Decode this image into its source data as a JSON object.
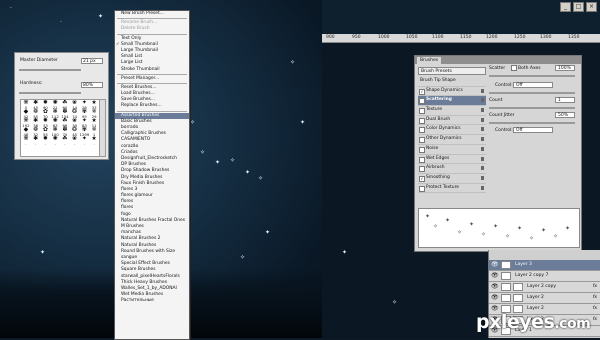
{
  "brush_picker": {
    "master_diameter_label": "Master Diameter",
    "master_diameter_value": "21 px",
    "hardness_label": "Hardness:",
    "hardness_value": "80%",
    "tips": [
      "5",
      "45",
      "90",
      "21",
      "60",
      "14",
      "26",
      "33",
      "42",
      "55",
      "70",
      "112",
      "134",
      "74",
      "95",
      "29",
      "192",
      "36",
      "33",
      "63",
      "66",
      "39",
      "63",
      "11",
      "48",
      "32",
      "55",
      "100",
      "75",
      "45",
      "1299",
      "1",
      ".",
      ".",
      ".",
      ".",
      ".",
      ".",
      ".",
      "."
    ]
  },
  "menu": {
    "items": [
      {
        "label": "New Brush Preset...",
        "state": "normal"
      },
      {
        "sep": true
      },
      {
        "label": "Rename Brush...",
        "state": "disabled"
      },
      {
        "label": "Delete Brush",
        "state": "disabled"
      },
      {
        "sep": true
      },
      {
        "label": "Text Only",
        "state": "normal"
      },
      {
        "label": "Small Thumbnail",
        "state": "checked"
      },
      {
        "label": "Large Thumbnail",
        "state": "normal"
      },
      {
        "label": "Small List",
        "state": "normal"
      },
      {
        "label": "Large List",
        "state": "normal"
      },
      {
        "label": "Stroke Thumbnail",
        "state": "normal"
      },
      {
        "sep": true
      },
      {
        "label": "Preset Manager...",
        "state": "normal"
      },
      {
        "sep": true
      },
      {
        "label": "Reset Brushes...",
        "state": "normal"
      },
      {
        "label": "Load Brushes...",
        "state": "normal"
      },
      {
        "label": "Save Brushes...",
        "state": "normal"
      },
      {
        "label": "Replace Brushes...",
        "state": "normal"
      },
      {
        "sep": true
      },
      {
        "label": "Assorted Brushes",
        "state": "selected"
      },
      {
        "label": "Basic Brushes",
        "state": "normal"
      },
      {
        "label": "borrado",
        "state": "normal"
      },
      {
        "label": "Calligraphic Brushes",
        "state": "normal"
      },
      {
        "label": "CASAMIENTO",
        "state": "normal"
      },
      {
        "label": "corazão",
        "state": "normal"
      },
      {
        "label": "Criados",
        "state": "normal"
      },
      {
        "label": "Designfruit_Electrosketch",
        "state": "normal"
      },
      {
        "label": "DP Brushes",
        "state": "normal"
      },
      {
        "label": "Drop Shadow Brushes",
        "state": "normal"
      },
      {
        "label": "Dry Media Brushes",
        "state": "normal"
      },
      {
        "label": "Faux Finish Brushes",
        "state": "normal"
      },
      {
        "label": "flores 3",
        "state": "normal"
      },
      {
        "label": "flores glamour",
        "state": "normal"
      },
      {
        "label": "flores",
        "state": "normal"
      },
      {
        "label": "flores",
        "state": "normal"
      },
      {
        "label": "fogo",
        "state": "normal"
      },
      {
        "label": "Natural Brushes Fractal Ones",
        "state": "normal"
      },
      {
        "label": "M Brushes",
        "state": "normal"
      },
      {
        "label": "manchas",
        "state": "normal"
      },
      {
        "label": "Natural Brushes 2",
        "state": "normal"
      },
      {
        "label": "Natural Brushes",
        "state": "normal"
      },
      {
        "label": "Round Brushes with Size",
        "state": "normal"
      },
      {
        "label": "sangue",
        "state": "normal"
      },
      {
        "label": "Special Effect Brushes",
        "state": "normal"
      },
      {
        "label": "Square Brushes",
        "state": "normal"
      },
      {
        "label": "starwall_pixelHeartsFlorals",
        "state": "normal"
      },
      {
        "label": "Thick Heavy Brushes",
        "state": "normal"
      },
      {
        "label": "Walles_Set_1_by_ADONAI",
        "state": "normal"
      },
      {
        "label": "Wet Media Brushes",
        "state": "normal"
      },
      {
        "label": "Растительные",
        "state": "normal"
      }
    ]
  },
  "brushes_panel": {
    "tab_label": "Brushes",
    "presets_button": "Brush Presets",
    "options": [
      {
        "label": "Brush Tip Shape",
        "checkbox": false,
        "checked": false,
        "selected": false
      },
      {
        "label": "Shape Dynamics",
        "checkbox": true,
        "checked": true,
        "selected": false
      },
      {
        "label": "Scattering",
        "checkbox": true,
        "checked": true,
        "selected": true
      },
      {
        "label": "Texture",
        "checkbox": true,
        "checked": false,
        "selected": false
      },
      {
        "label": "Dual Brush",
        "checkbox": true,
        "checked": false,
        "selected": false
      },
      {
        "label": "Color Dynamics",
        "checkbox": true,
        "checked": false,
        "selected": false
      },
      {
        "label": "Other Dynamics",
        "checkbox": true,
        "checked": false,
        "selected": false
      },
      {
        "label": "Noise",
        "checkbox": true,
        "checked": false,
        "selected": false
      },
      {
        "label": "Wet Edges",
        "checkbox": true,
        "checked": false,
        "selected": false
      },
      {
        "label": "Airbrush",
        "checkbox": true,
        "checked": false,
        "selected": false
      },
      {
        "label": "Smoothing",
        "checkbox": true,
        "checked": true,
        "selected": false
      },
      {
        "label": "Protect Texture",
        "checkbox": true,
        "checked": false,
        "selected": false
      }
    ],
    "scatter_label": "Scatter",
    "both_axes_label": "Both Axes",
    "scatter_value": "100%",
    "control_label": "Control:",
    "control_value": "Off",
    "count_label": "Count",
    "count_value": "1",
    "count_jitter_label": "Count Jitter",
    "count_jitter_value": "50%",
    "control2_value": "Off"
  },
  "layers": [
    {
      "name": "Layer 3",
      "selected": true,
      "fx": false
    },
    {
      "name": "Layer 2 copy 7",
      "selected": false,
      "fx": false
    },
    {
      "name": "Layer 2 copy",
      "selected": false,
      "fx": true
    },
    {
      "name": "Layer 2",
      "selected": false,
      "fx": true
    },
    {
      "name": "Layer 2",
      "selected": false,
      "fx": true
    },
    {
      "name": "Layer 2",
      "selected": false,
      "fx": true
    },
    {
      "name": "Layer 1",
      "selected": false,
      "fx": false
    }
  ],
  "ruler_labels": [
    "900",
    "950",
    "1000",
    "1050",
    "1100",
    "1150",
    "1200",
    "1250",
    "1300",
    "1350"
  ],
  "window_buttons": [
    "_",
    "□",
    "×"
  ],
  "watermark": {
    "main": "pxleyes",
    "suffix": ".com"
  }
}
